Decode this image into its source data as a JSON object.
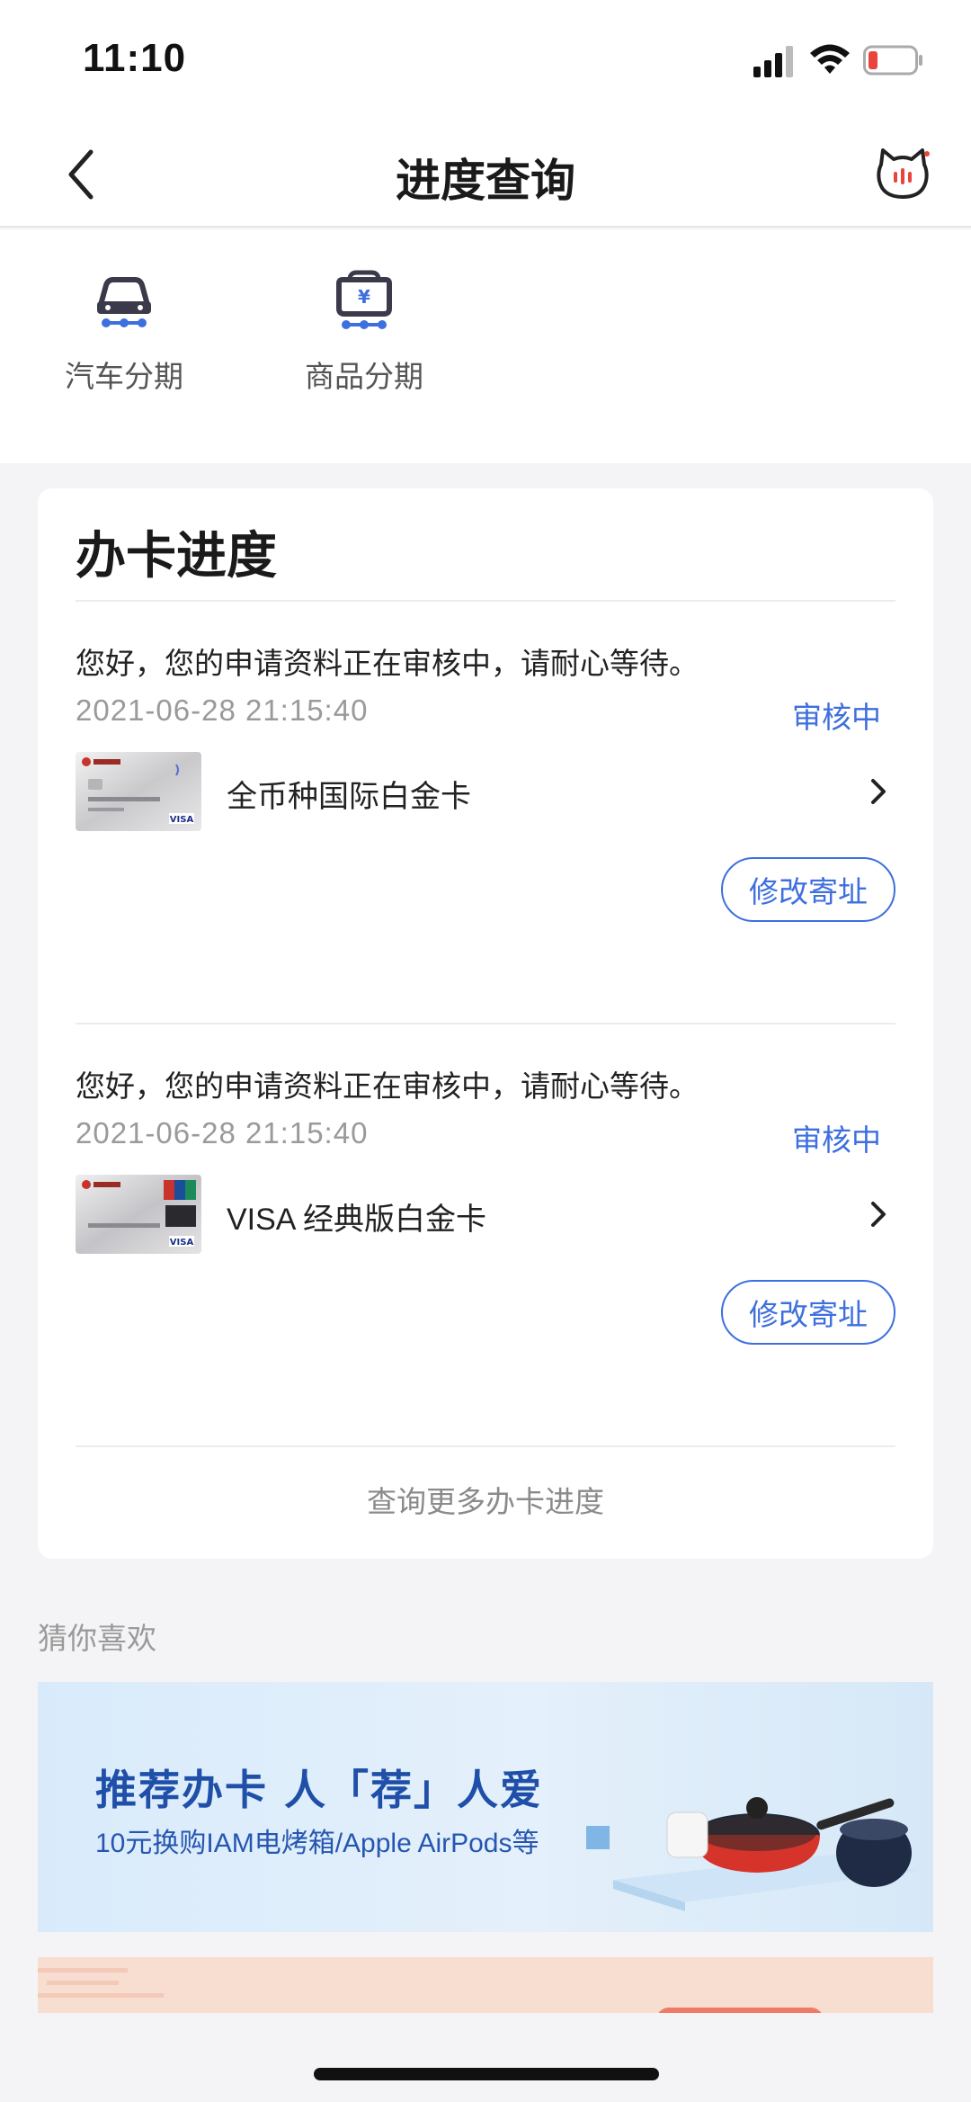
{
  "status_bar": {
    "time": "11:10"
  },
  "nav": {
    "title": "进度查询"
  },
  "quick_actions": [
    {
      "label": "汽车分期",
      "icon": "car-icon"
    },
    {
      "label": "商品分期",
      "icon": "product-yen-icon"
    }
  ],
  "progress": {
    "title": "办卡进度",
    "entries": [
      {
        "message": "您好，您的申请资料正在审核中，请耐心等待。",
        "time": "2021-06-28 21:15:40",
        "status": "审核中",
        "card_name": "全币种国际白金卡",
        "action": "修改寄址"
      },
      {
        "message": "您好，您的申请资料正在审核中，请耐心等待。",
        "time": "2021-06-28 21:15:40",
        "status": "审核中",
        "card_name": "VISA 经典版白金卡",
        "action": "修改寄址"
      }
    ],
    "more": "查询更多办卡进度"
  },
  "recommend": {
    "title": "猜你喜欢",
    "banner_title": "推荐办卡  人「荐」人爱",
    "banner_sub": "10元换购IAM电烤箱/Apple AirPods等"
  },
  "colors": {
    "accent": "#3e6fde",
    "background": "#f4f4f6"
  }
}
